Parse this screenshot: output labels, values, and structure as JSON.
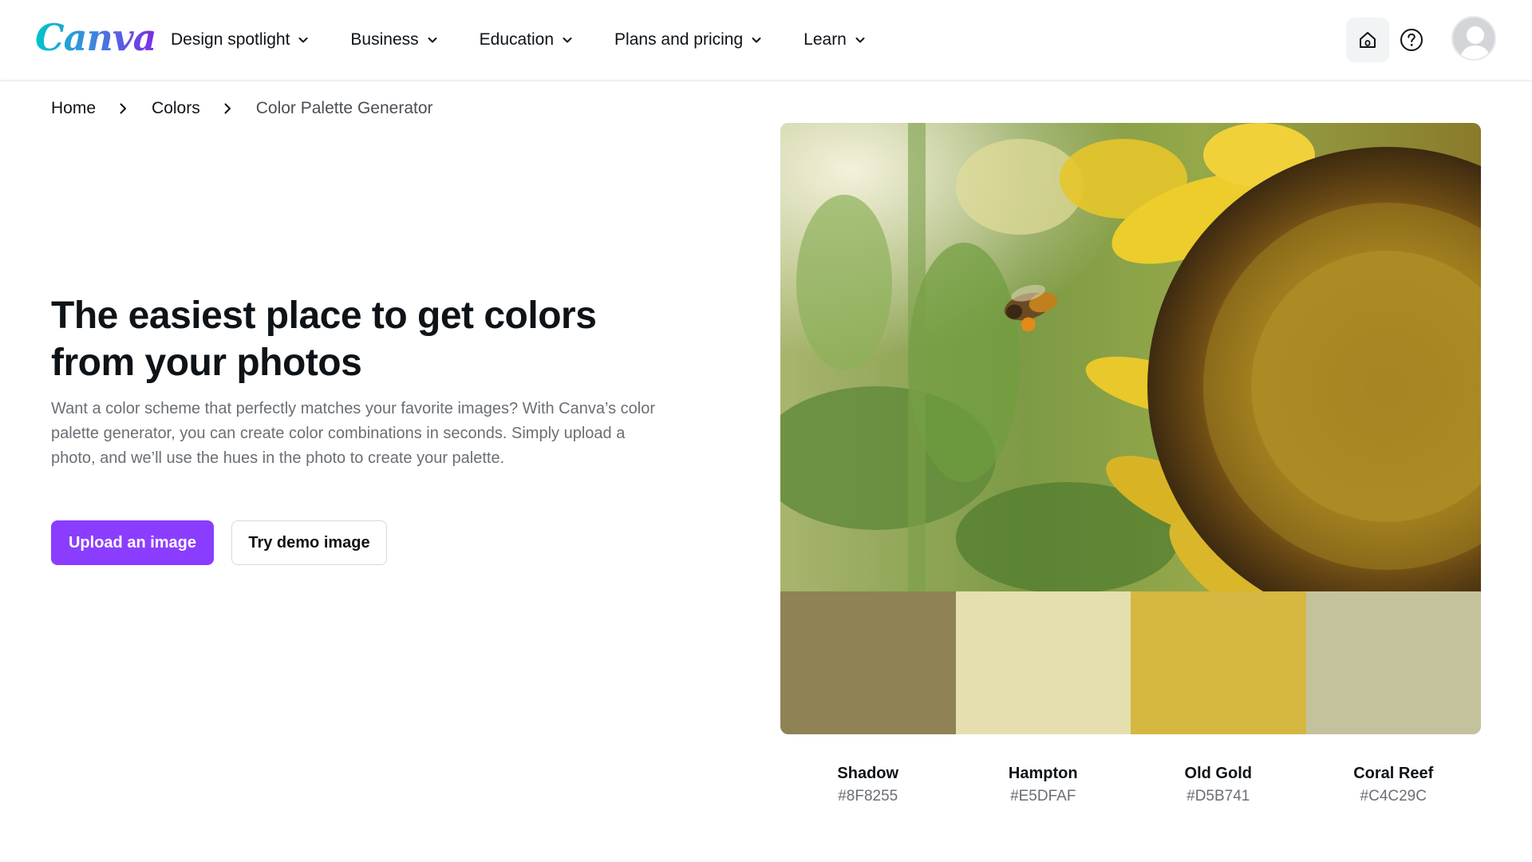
{
  "header": {
    "logo_text": "Canva",
    "nav": [
      {
        "label": "Design spotlight"
      },
      {
        "label": "Business"
      },
      {
        "label": "Education"
      },
      {
        "label": "Plans and pricing"
      },
      {
        "label": "Learn"
      }
    ],
    "icons": [
      "home-icon",
      "help-icon",
      "avatar"
    ]
  },
  "breadcrumb": [
    "Home",
    "Colors",
    "Color Palette Generator"
  ],
  "hero": {
    "title": "The easiest place to get colors from your photos",
    "description": "Want a color scheme that perfectly matches your favorite images? With Canva’s color palette generator, you can create color combinations in seconds. Simply upload a photo, and we’ll use the hues in the photo to create your palette.",
    "primary_button": "Upload an image",
    "secondary_button": "Try demo image"
  },
  "palette": [
    {
      "name": "Shadow",
      "hex": "#8F8255"
    },
    {
      "name": "Hampton",
      "hex": "#E5DFAF"
    },
    {
      "name": "Old Gold",
      "hex": "#D5B741"
    },
    {
      "name": "Coral Reef",
      "hex": "#C4C29C"
    }
  ],
  "colors": {
    "brand_purple": "#8B3DFF",
    "text_primary": "#0E1318",
    "text_secondary": "#6A6F75"
  }
}
